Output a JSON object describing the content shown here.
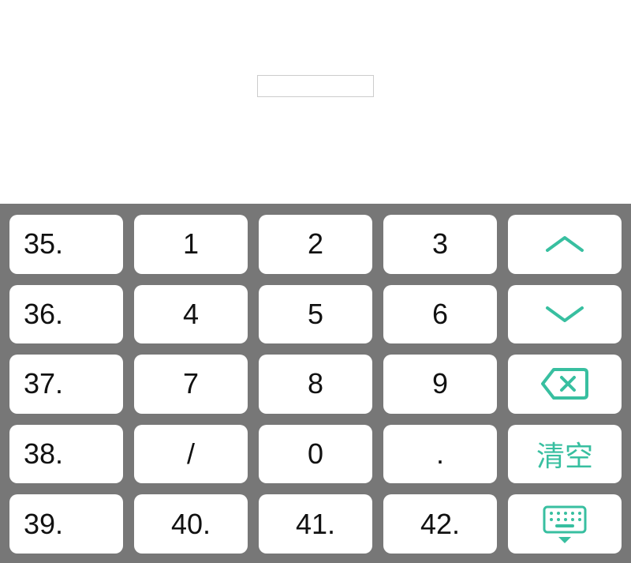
{
  "input": {
    "value": ""
  },
  "accent": "#38bfa0",
  "keyboard": {
    "rows": [
      [
        {
          "id": "num-35",
          "label": "35.",
          "align": "left"
        },
        {
          "id": "digit-1",
          "label": "1"
        },
        {
          "id": "digit-2",
          "label": "2"
        },
        {
          "id": "digit-3",
          "label": "3"
        },
        {
          "id": "action-up",
          "icon": "chevron-up"
        }
      ],
      [
        {
          "id": "num-36",
          "label": "36.",
          "align": "left"
        },
        {
          "id": "digit-4",
          "label": "4"
        },
        {
          "id": "digit-5",
          "label": "5"
        },
        {
          "id": "digit-6",
          "label": "6"
        },
        {
          "id": "action-down",
          "icon": "chevron-down"
        }
      ],
      [
        {
          "id": "num-37",
          "label": "37.",
          "align": "left"
        },
        {
          "id": "digit-7",
          "label": "7"
        },
        {
          "id": "digit-8",
          "label": "8"
        },
        {
          "id": "digit-9",
          "label": "9"
        },
        {
          "id": "action-backspace",
          "icon": "backspace"
        }
      ],
      [
        {
          "id": "num-38",
          "label": "38.",
          "align": "left"
        },
        {
          "id": "slash",
          "label": "/"
        },
        {
          "id": "digit-0",
          "label": "0"
        },
        {
          "id": "dot",
          "label": "."
        },
        {
          "id": "action-clear",
          "label": "清空",
          "accent": true
        }
      ],
      [
        {
          "id": "num-39",
          "label": "39.",
          "align": "left"
        },
        {
          "id": "num-40",
          "label": "40."
        },
        {
          "id": "num-41",
          "label": "41."
        },
        {
          "id": "num-42",
          "label": "42."
        },
        {
          "id": "action-dismiss",
          "icon": "keyboard-dismiss"
        }
      ]
    ]
  }
}
